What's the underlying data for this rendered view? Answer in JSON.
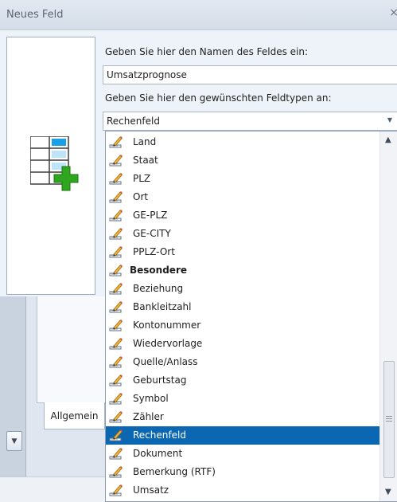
{
  "window": {
    "title": "Neues Feld",
    "close_glyph": "×"
  },
  "form": {
    "name_prompt": "Geben Sie hier den Namen des Feldes ein:",
    "name_value": "Umsatzprognose",
    "type_prompt": "Geben Sie hier den gewünschten Feldtypen an:",
    "type_value": "Rechenfeld"
  },
  "dropdown": {
    "items": [
      {
        "label": "Land",
        "group": false,
        "selected": false
      },
      {
        "label": "Staat",
        "group": false,
        "selected": false
      },
      {
        "label": "PLZ",
        "group": false,
        "selected": false
      },
      {
        "label": "Ort",
        "group": false,
        "selected": false
      },
      {
        "label": "GE-PLZ",
        "group": false,
        "selected": false
      },
      {
        "label": "GE-CITY",
        "group": false,
        "selected": false
      },
      {
        "label": "PPLZ-Ort",
        "group": false,
        "selected": false
      },
      {
        "label": "Besondere",
        "group": true,
        "selected": false
      },
      {
        "label": "Beziehung",
        "group": false,
        "selected": false
      },
      {
        "label": "Bankleitzahl",
        "group": false,
        "selected": false
      },
      {
        "label": "Kontonummer",
        "group": false,
        "selected": false
      },
      {
        "label": "Wiedervorlage",
        "group": false,
        "selected": false
      },
      {
        "label": "Quelle/Anlass",
        "group": false,
        "selected": false
      },
      {
        "label": "Geburtstag",
        "group": false,
        "selected": false
      },
      {
        "label": "Symbol",
        "group": false,
        "selected": false
      },
      {
        "label": "Zähler",
        "group": false,
        "selected": false
      },
      {
        "label": "Rechenfeld",
        "group": false,
        "selected": true
      },
      {
        "label": "Dokument",
        "group": false,
        "selected": false
      },
      {
        "label": "Bemerkung (RTF)",
        "group": false,
        "selected": false
      },
      {
        "label": "Umsatz",
        "group": false,
        "selected": false
      }
    ]
  },
  "background": {
    "tab_label": "Allgemein"
  },
  "icons": {
    "field": "new-field-icon",
    "item": "pencil-ruler-icon"
  },
  "colors": {
    "selection": "#0b67b2",
    "plus": "#2fa61f"
  }
}
